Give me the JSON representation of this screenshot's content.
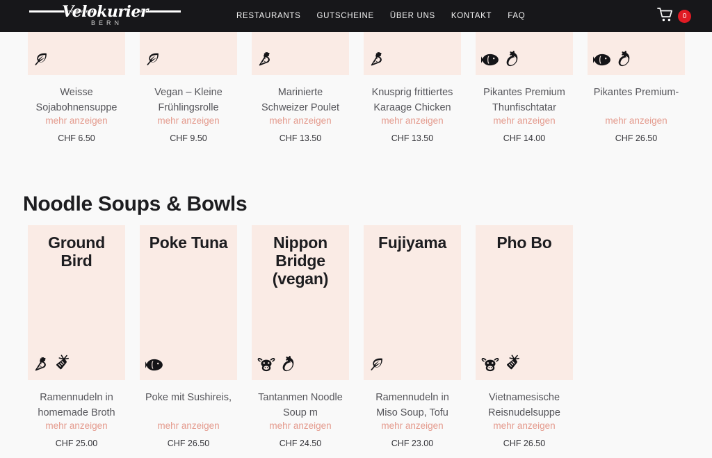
{
  "header": {
    "brand": {
      "word": "Velokurier",
      "sub": "BERN",
      "icon": "velokurier-logo"
    },
    "nav": [
      {
        "label": "RESTAURANTS"
      },
      {
        "label": "GUTSCHEINE"
      },
      {
        "label": "ÜBER UNS"
      },
      {
        "label": "KONTAKT"
      },
      {
        "label": "FAQ"
      }
    ],
    "cart": {
      "icon": "shopping-cart-icon",
      "count": "0"
    }
  },
  "colors": {
    "header_bg": "#17171a",
    "page_bg": "#f9f9f9",
    "card_media_bg": "#faebe5",
    "accent_link": "#e49a8d",
    "badge_red": "#e01b24"
  },
  "sections": [
    {
      "heading": "",
      "items": [
        {
          "media_title": "",
          "badges": [
            "leaf-icon"
          ],
          "title": "Weisse Sojabohnensuppe",
          "more_label": "mehr anzeigen",
          "price": "CHF 6.50"
        },
        {
          "media_title": "",
          "badges": [
            "leaf-icon"
          ],
          "title": "Vegan – Kleine Frühlingsrolle",
          "more_label": "mehr anzeigen",
          "price": "CHF 9.50"
        },
        {
          "media_title": "",
          "badges": [
            "chicken-icon"
          ],
          "title": "Marinierte Schweizer Poulet",
          "more_label": "mehr anzeigen",
          "price": "CHF 13.50"
        },
        {
          "media_title": "",
          "badges": [
            "chicken-icon"
          ],
          "title": "Knusprig frittiertes Karaage Chicken",
          "more_label": "mehr anzeigen",
          "price": "CHF 13.50"
        },
        {
          "media_title": "",
          "badges": [
            "fish-icon",
            "chili-icon"
          ],
          "title": "Pikantes Premium Thunfischtatar",
          "more_label": "mehr anzeigen",
          "price": "CHF 14.00"
        },
        {
          "media_title": "",
          "badges": [
            "fish-icon",
            "chili-icon"
          ],
          "title": "Pikantes Premium-",
          "more_label": "mehr anzeigen",
          "price": "CHF 26.50"
        }
      ]
    },
    {
      "heading": "Noodle Soups & Bowls",
      "items": [
        {
          "media_title": "Ground Bird",
          "badges": [
            "chicken-icon",
            "carrot-icon"
          ],
          "title": "Ramennudeln in homemade Broth",
          "more_label": "mehr anzeigen",
          "price": "CHF 25.00"
        },
        {
          "media_title": "Poke Tuna",
          "badges": [
            "fish-icon"
          ],
          "title": "Poke mit Sushireis,",
          "more_label": "mehr anzeigen",
          "price": "CHF 26.50"
        },
        {
          "media_title": "Nippon Bridge (vegan)",
          "badges": [
            "cow-icon",
            "chili-icon"
          ],
          "title": "Tantanmen Noodle Soup m",
          "more_label": "mehr anzeigen",
          "price": "CHF 24.50"
        },
        {
          "media_title": "Fujiyama",
          "badges": [
            "leaf-icon"
          ],
          "title": "Ramennudeln in Miso Soup, Tofu",
          "more_label": "mehr anzeigen",
          "price": "CHF 23.00"
        },
        {
          "media_title": "Pho Bo",
          "badges": [
            "cow-icon",
            "carrot-icon"
          ],
          "title": "Vietnamesische Reisnudelsuppe",
          "more_label": "mehr anzeigen",
          "price": "CHF 26.50"
        }
      ]
    }
  ]
}
